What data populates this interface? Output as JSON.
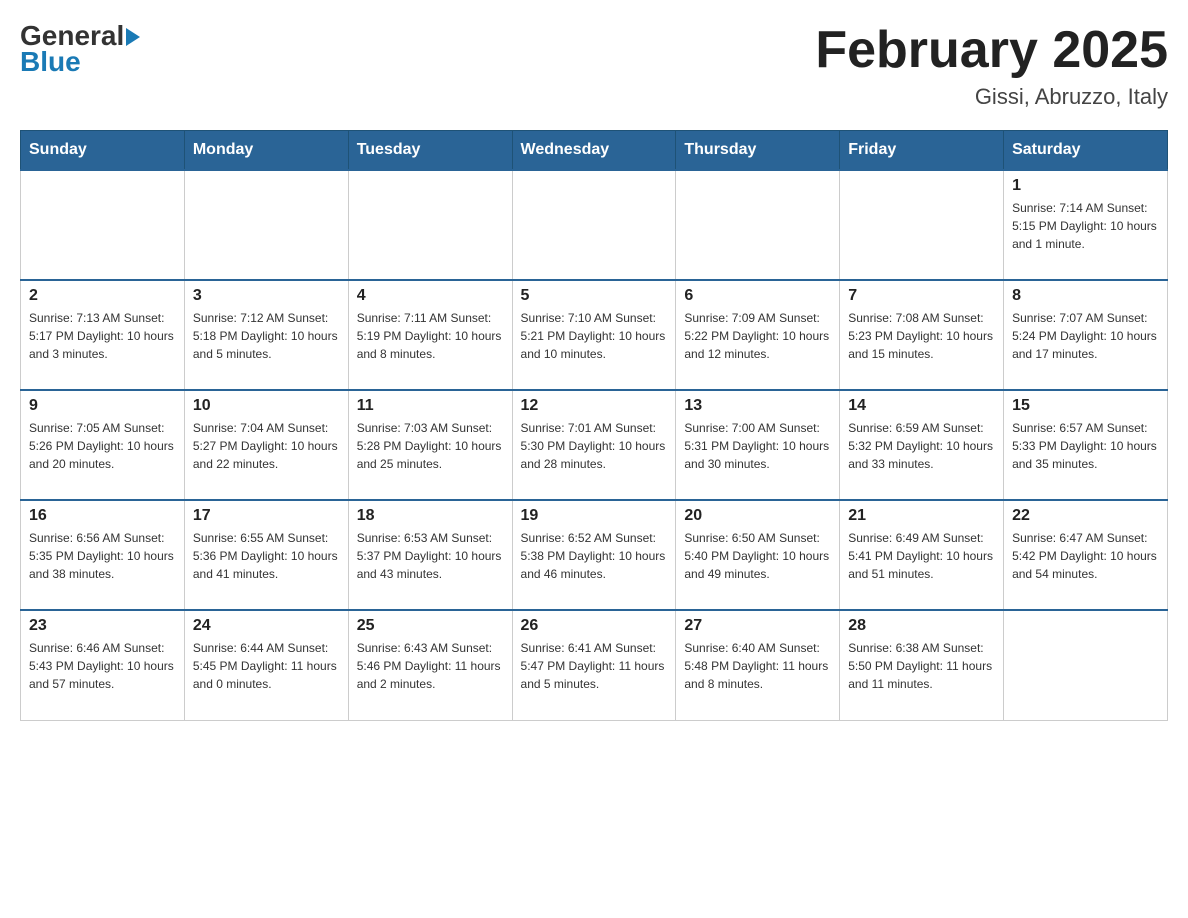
{
  "header": {
    "logo_general": "General",
    "logo_blue": "Blue",
    "month_title": "February 2025",
    "location": "Gissi, Abruzzo, Italy"
  },
  "days_of_week": [
    "Sunday",
    "Monday",
    "Tuesday",
    "Wednesday",
    "Thursday",
    "Friday",
    "Saturday"
  ],
  "weeks": [
    [
      {
        "day": "",
        "info": ""
      },
      {
        "day": "",
        "info": ""
      },
      {
        "day": "",
        "info": ""
      },
      {
        "day": "",
        "info": ""
      },
      {
        "day": "",
        "info": ""
      },
      {
        "day": "",
        "info": ""
      },
      {
        "day": "1",
        "info": "Sunrise: 7:14 AM\nSunset: 5:15 PM\nDaylight: 10 hours and 1 minute."
      }
    ],
    [
      {
        "day": "2",
        "info": "Sunrise: 7:13 AM\nSunset: 5:17 PM\nDaylight: 10 hours and 3 minutes."
      },
      {
        "day": "3",
        "info": "Sunrise: 7:12 AM\nSunset: 5:18 PM\nDaylight: 10 hours and 5 minutes."
      },
      {
        "day": "4",
        "info": "Sunrise: 7:11 AM\nSunset: 5:19 PM\nDaylight: 10 hours and 8 minutes."
      },
      {
        "day": "5",
        "info": "Sunrise: 7:10 AM\nSunset: 5:21 PM\nDaylight: 10 hours and 10 minutes."
      },
      {
        "day": "6",
        "info": "Sunrise: 7:09 AM\nSunset: 5:22 PM\nDaylight: 10 hours and 12 minutes."
      },
      {
        "day": "7",
        "info": "Sunrise: 7:08 AM\nSunset: 5:23 PM\nDaylight: 10 hours and 15 minutes."
      },
      {
        "day": "8",
        "info": "Sunrise: 7:07 AM\nSunset: 5:24 PM\nDaylight: 10 hours and 17 minutes."
      }
    ],
    [
      {
        "day": "9",
        "info": "Sunrise: 7:05 AM\nSunset: 5:26 PM\nDaylight: 10 hours and 20 minutes."
      },
      {
        "day": "10",
        "info": "Sunrise: 7:04 AM\nSunset: 5:27 PM\nDaylight: 10 hours and 22 minutes."
      },
      {
        "day": "11",
        "info": "Sunrise: 7:03 AM\nSunset: 5:28 PM\nDaylight: 10 hours and 25 minutes."
      },
      {
        "day": "12",
        "info": "Sunrise: 7:01 AM\nSunset: 5:30 PM\nDaylight: 10 hours and 28 minutes."
      },
      {
        "day": "13",
        "info": "Sunrise: 7:00 AM\nSunset: 5:31 PM\nDaylight: 10 hours and 30 minutes."
      },
      {
        "day": "14",
        "info": "Sunrise: 6:59 AM\nSunset: 5:32 PM\nDaylight: 10 hours and 33 minutes."
      },
      {
        "day": "15",
        "info": "Sunrise: 6:57 AM\nSunset: 5:33 PM\nDaylight: 10 hours and 35 minutes."
      }
    ],
    [
      {
        "day": "16",
        "info": "Sunrise: 6:56 AM\nSunset: 5:35 PM\nDaylight: 10 hours and 38 minutes."
      },
      {
        "day": "17",
        "info": "Sunrise: 6:55 AM\nSunset: 5:36 PM\nDaylight: 10 hours and 41 minutes."
      },
      {
        "day": "18",
        "info": "Sunrise: 6:53 AM\nSunset: 5:37 PM\nDaylight: 10 hours and 43 minutes."
      },
      {
        "day": "19",
        "info": "Sunrise: 6:52 AM\nSunset: 5:38 PM\nDaylight: 10 hours and 46 minutes."
      },
      {
        "day": "20",
        "info": "Sunrise: 6:50 AM\nSunset: 5:40 PM\nDaylight: 10 hours and 49 minutes."
      },
      {
        "day": "21",
        "info": "Sunrise: 6:49 AM\nSunset: 5:41 PM\nDaylight: 10 hours and 51 minutes."
      },
      {
        "day": "22",
        "info": "Sunrise: 6:47 AM\nSunset: 5:42 PM\nDaylight: 10 hours and 54 minutes."
      }
    ],
    [
      {
        "day": "23",
        "info": "Sunrise: 6:46 AM\nSunset: 5:43 PM\nDaylight: 10 hours and 57 minutes."
      },
      {
        "day": "24",
        "info": "Sunrise: 6:44 AM\nSunset: 5:45 PM\nDaylight: 11 hours and 0 minutes."
      },
      {
        "day": "25",
        "info": "Sunrise: 6:43 AM\nSunset: 5:46 PM\nDaylight: 11 hours and 2 minutes."
      },
      {
        "day": "26",
        "info": "Sunrise: 6:41 AM\nSunset: 5:47 PM\nDaylight: 11 hours and 5 minutes."
      },
      {
        "day": "27",
        "info": "Sunrise: 6:40 AM\nSunset: 5:48 PM\nDaylight: 11 hours and 8 minutes."
      },
      {
        "day": "28",
        "info": "Sunrise: 6:38 AM\nSunset: 5:50 PM\nDaylight: 11 hours and 11 minutes."
      },
      {
        "day": "",
        "info": ""
      }
    ]
  ]
}
